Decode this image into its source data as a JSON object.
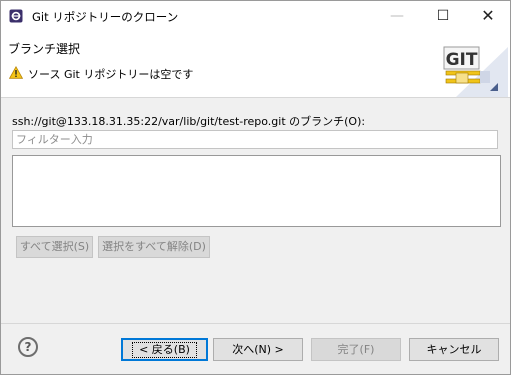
{
  "window": {
    "title": "Git リポジトリーのクローン",
    "controls": {
      "minimize": "—",
      "maximize": "☐",
      "close": "✕"
    }
  },
  "header": {
    "page_title": "ブランチ選択",
    "warning_message": "ソース Git リポジトリーは空です",
    "logo_text": "GIT"
  },
  "main": {
    "repo_label": "ssh://git@133.18.31.35:22/var/lib/git/test-repo.git のブランチ(O):",
    "filter_placeholder": "フィルター入力",
    "select_all_label": "すべて選択(S)",
    "deselect_all_label": "選択をすべて解除(D)"
  },
  "footer": {
    "help_label": "?",
    "back_label": "< 戻る(B)",
    "next_label": "次へ(N) >",
    "finish_label": "完了(F)",
    "cancel_label": "キャンセル"
  }
}
